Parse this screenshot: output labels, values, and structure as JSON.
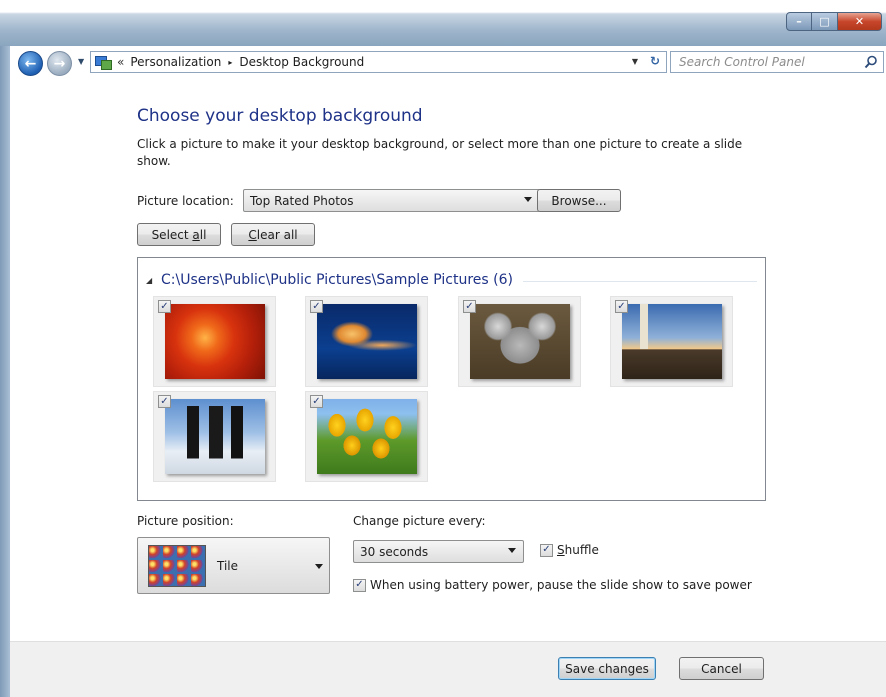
{
  "window": {
    "min_glyph": "–",
    "max_glyph": "□",
    "close_glyph": "✕"
  },
  "nav": {
    "back_glyph": "←",
    "forward_glyph": "→",
    "overflow": "«",
    "breadcrumbs": [
      "Personalization",
      "Desktop Background"
    ],
    "separator": "▸",
    "search_placeholder": "Search Control Panel"
  },
  "page": {
    "title": "Choose your desktop background",
    "description": "Click a picture to make it your desktop background, or select more than one picture to create a slide show.",
    "picture_location_label": "Picture location:",
    "picture_location_value": "Top Rated Photos",
    "browse_label": "Browse...",
    "select_all_label": "Select all",
    "select_all_accel": "a",
    "clear_all_label": "Clear all",
    "clear_all_accel": "C"
  },
  "gallery": {
    "group_header": "C:\\Users\\Public\\Public Pictures\\Sample Pictures (6)",
    "items": [
      {
        "name": "chrysanthemum",
        "checked": true,
        "icon": "red-flower"
      },
      {
        "name": "jellyfish",
        "checked": true,
        "icon": "jellyfish"
      },
      {
        "name": "koala",
        "checked": true,
        "icon": "koala"
      },
      {
        "name": "lighthouse",
        "checked": true,
        "icon": "lighthouse"
      },
      {
        "name": "penguins",
        "checked": true,
        "icon": "penguins"
      },
      {
        "name": "tulips",
        "checked": true,
        "icon": "tulips"
      }
    ]
  },
  "position": {
    "label": "Picture position:",
    "value": "Tile"
  },
  "slideshow": {
    "change_label": "Change picture every:",
    "interval_value": "30 seconds",
    "shuffle_label": "Shuffle",
    "shuffle_checked": true,
    "battery_label": "When using battery power, pause the slide show to save power",
    "battery_checked": true
  },
  "footer": {
    "save_label": "Save changes",
    "cancel_label": "Cancel"
  },
  "colors": {
    "title_blue": "#1e3287",
    "frame_blue": "#9fb6cc"
  }
}
